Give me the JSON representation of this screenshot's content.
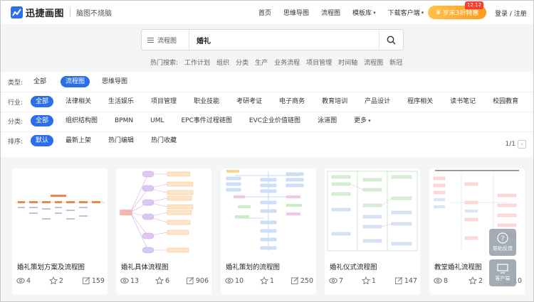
{
  "header": {
    "logo_text": "迅捷画图",
    "slogan": "脑图不烧脑",
    "nav": [
      {
        "label": "首页"
      },
      {
        "label": "思维导图"
      },
      {
        "label": "流程图"
      },
      {
        "label": "模板库",
        "dropdown": true
      },
      {
        "label": "下载客户端",
        "dropdown": true
      }
    ],
    "vip_label": "岁末3折特惠",
    "vip_badge": "12.12",
    "login": "登录 / 注册",
    "accent": "#2a6ee8"
  },
  "search": {
    "category": "流程图",
    "value": "婚礼",
    "hot_label": "热门搜索:",
    "hot": [
      "工作计划",
      "组织",
      "分类",
      "生产",
      "业务流程",
      "项目管理",
      "时间轴",
      "流程图",
      "新冠"
    ]
  },
  "filters": {
    "type": {
      "label": "类型:",
      "options": [
        "全部",
        "流程图",
        "思维导图"
      ],
      "active": 1
    },
    "industry": {
      "label": "行业:",
      "options": [
        "全部",
        "法律相关",
        "生活娱乐",
        "项目管理",
        "职业技能",
        "考研考证",
        "电子商务",
        "教育培训",
        "产品设计",
        "程序相关",
        "读书笔记",
        "校园教育"
      ],
      "active": 0
    },
    "category": {
      "label": "分类:",
      "options": [
        "全部",
        "组织结构图",
        "BPMN",
        "UML",
        "EPC事件过程链图",
        "EVC企业价值链图",
        "泳道图"
      ],
      "more": "更多",
      "active": 0
    },
    "sort": {
      "label": "排序:",
      "options": [
        "默认",
        "最新上架",
        "热门编辑",
        "热门收藏"
      ],
      "active": 0
    }
  },
  "pager": "1/1",
  "cards": [
    {
      "title": "婚礼策划方案及流程图",
      "views": "4",
      "stars": "2",
      "edits": "159"
    },
    {
      "title": "婚礼具体流程图",
      "views": "13",
      "stars": "6",
      "edits": "906"
    },
    {
      "title": "婚礼策划的流程图",
      "views": "10",
      "stars": "1",
      "edits": "250"
    },
    {
      "title": "婚礼仪式流程图",
      "views": "7",
      "stars": "1",
      "edits": "147"
    },
    {
      "title": "教堂婚礼流程图",
      "views": "8",
      "stars": "2",
      "edits": "10"
    }
  ],
  "float": {
    "help": "帮助反馈",
    "service": "客户端"
  }
}
